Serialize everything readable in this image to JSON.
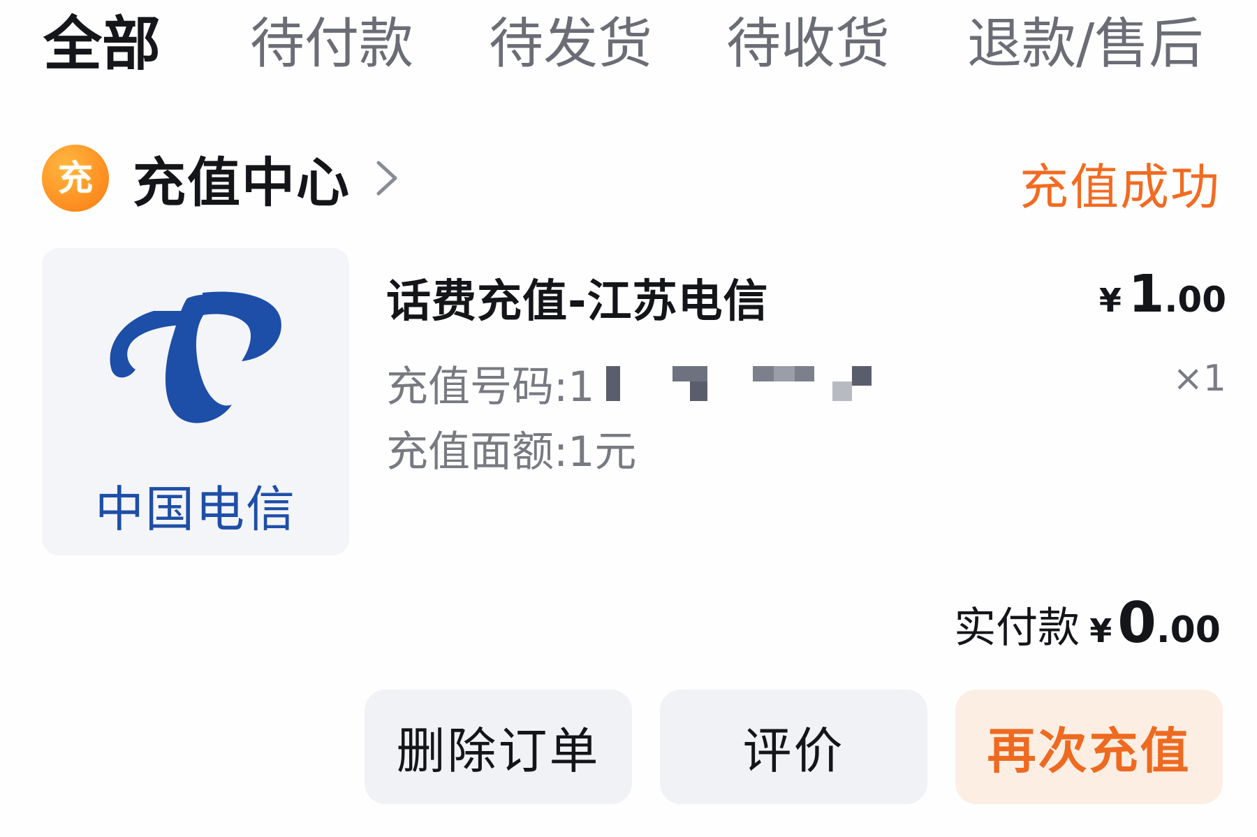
{
  "tabs": [
    {
      "label": "全部",
      "active": true
    },
    {
      "label": "待付款",
      "active": false
    },
    {
      "label": "待发货",
      "active": false
    },
    {
      "label": "待收货",
      "active": false
    },
    {
      "label": "退款/售后",
      "active": false
    }
  ],
  "order": {
    "shop": {
      "logo_text": "充",
      "name": "充值中心",
      "icon": "chevron-right-icon"
    },
    "status": "充值成功",
    "product": {
      "thumb_caption": "中国电信",
      "title": "话费充值-江苏电信",
      "price_symbol": "¥",
      "price_int": "1",
      "price_dec": ".00",
      "phone_label": "充值号码:1",
      "amount_label": "充值面额:1元",
      "quantity": "×1"
    },
    "total": {
      "label": "实付款",
      "symbol": "¥",
      "int": "0",
      "dec": ".00"
    },
    "actions": {
      "delete": "删除订单",
      "review": "评价",
      "recharge": "再次充值"
    }
  },
  "colors": {
    "accent_orange": "#f26b22",
    "telecom_blue": "#1e4fa8",
    "button_bg": "#f1f2f5",
    "primary_button_bg": "#fdeee3"
  }
}
